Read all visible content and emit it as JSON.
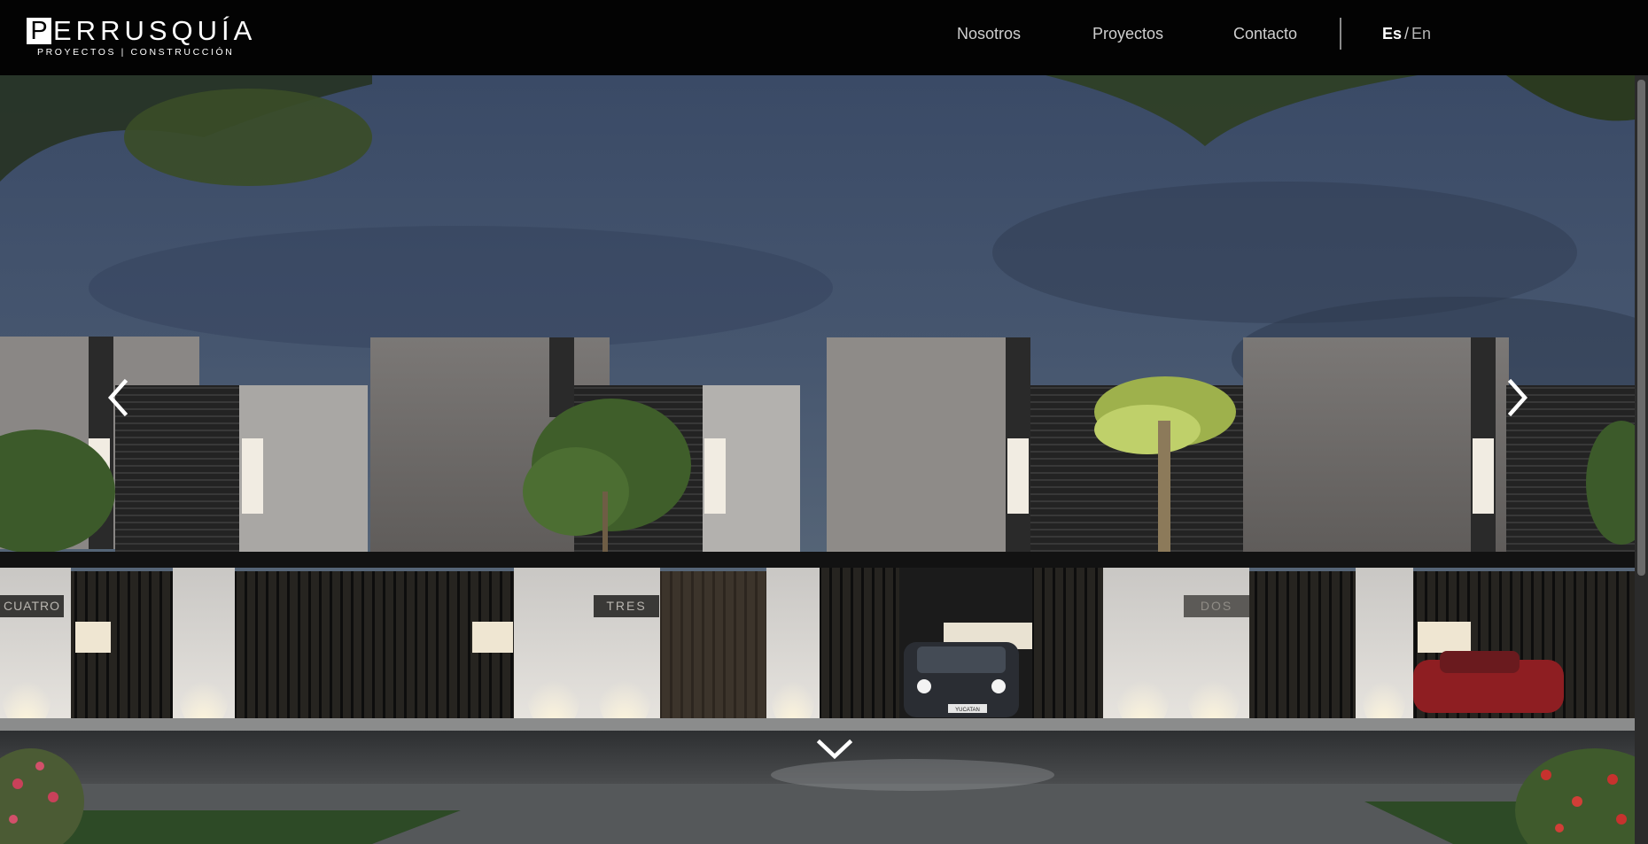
{
  "brand": {
    "logo_letter": "P",
    "logo_rest": "ERRUSQUÍA",
    "tagline": "PROYECTOS | CONSTRUCCIÓN"
  },
  "nav": {
    "items": [
      {
        "label": "Nosotros"
      },
      {
        "label": "Proyectos"
      },
      {
        "label": "Contacto"
      }
    ],
    "lang": {
      "es": "Es",
      "separator": "/",
      "en": "En"
    }
  },
  "hero": {
    "signs": {
      "left": "CUATRO",
      "center": "TRES",
      "right": "DOS"
    },
    "car_plate": "YUCATAN"
  },
  "icons": {
    "prev": "chevron-left-icon",
    "next": "chevron-right-icon",
    "scroll": "chevron-down-icon"
  },
  "colors": {
    "header_bg": "#030303",
    "nav_text": "#cfcfcf",
    "sky": "#3c4c66",
    "house_light": "#bdbdbd",
    "house_dark": "#1e1e1e"
  }
}
